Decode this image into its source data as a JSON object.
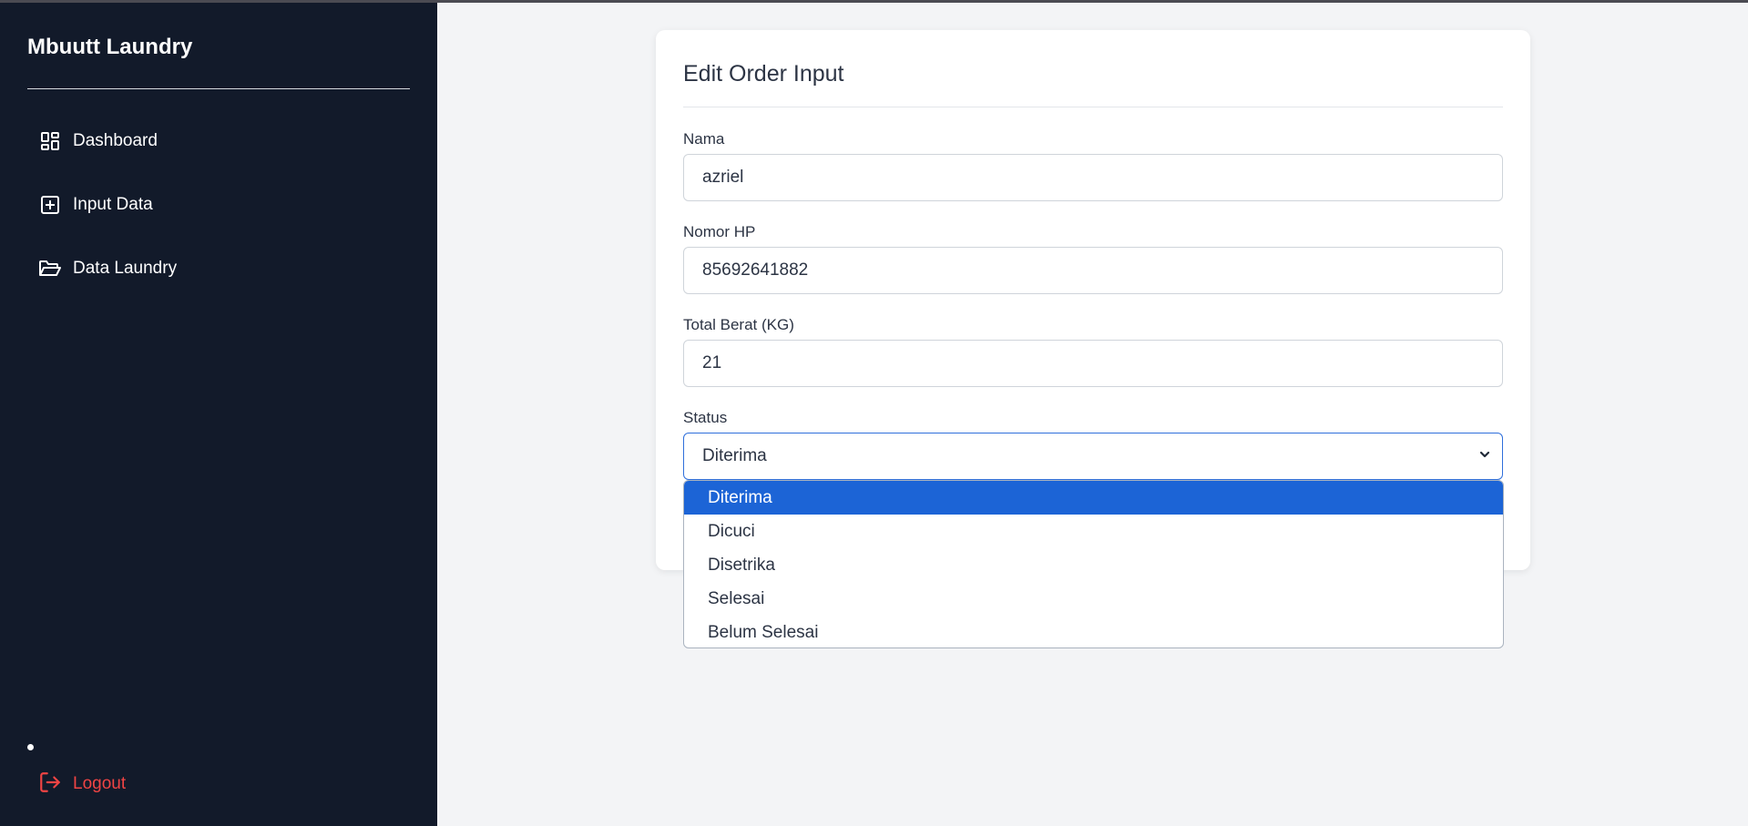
{
  "app": {
    "brand": "Mbuutt Laundry"
  },
  "sidebar": {
    "items": [
      {
        "label": "Dashboard",
        "icon": "dashboard-icon"
      },
      {
        "label": "Input Data",
        "icon": "plus-square-icon"
      },
      {
        "label": "Data Laundry",
        "icon": "folder-open-icon"
      }
    ],
    "logout": {
      "label": "Logout",
      "icon": "logout-icon"
    }
  },
  "form": {
    "title": "Edit Order Input",
    "fields": {
      "nama": {
        "label": "Nama",
        "value": "azriel"
      },
      "hp": {
        "label": "Nomor HP",
        "value": "85692641882"
      },
      "berat": {
        "label": "Total Berat (KG)",
        "value": "21"
      },
      "status": {
        "label": "Status",
        "value": "Diterima"
      }
    },
    "status_options": [
      "Diterima",
      "Dicuci",
      "Disetrika",
      "Selesai",
      "Belum Selesai"
    ],
    "selected_option": "Diterima"
  },
  "colors": {
    "sidebar_bg": "#121a2a",
    "accent": "#1c64d6",
    "logout": "#ef4444",
    "page_bg": "#f3f4f6"
  }
}
